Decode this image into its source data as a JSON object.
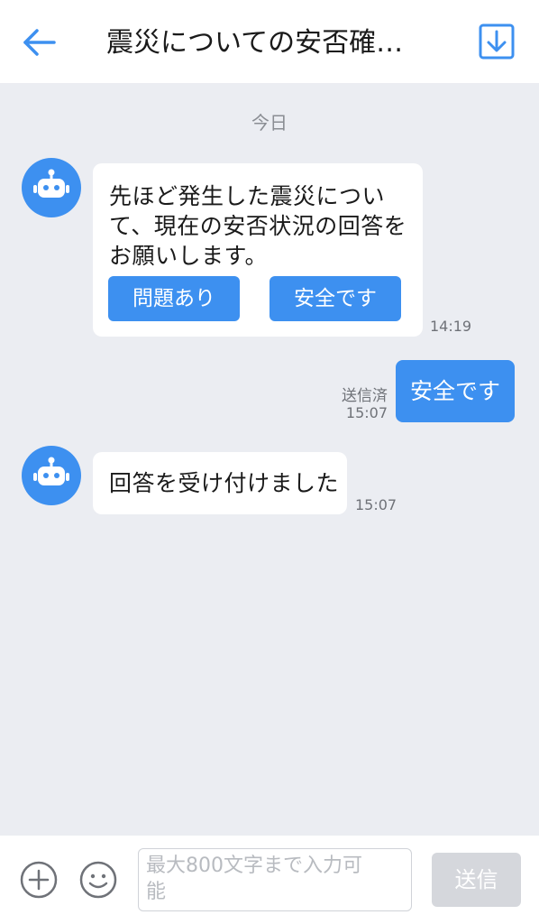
{
  "header": {
    "title": "震災についての安否確…",
    "back_icon": "arrow-left-icon",
    "download_icon": "download-icon",
    "accent_color": "#3d90f0"
  },
  "chat": {
    "date_label": "今日",
    "messages": [
      {
        "sender": "bot",
        "avatar_icon": "robot-icon",
        "text_lines": [
          "先ほど発生した震災につい",
          "て、現在の安否状況の回答を",
          "お願いします。"
        ],
        "buttons": [
          "問題あり",
          "安全です"
        ],
        "time": "14:19"
      },
      {
        "sender": "user",
        "text": "安全です",
        "status": "送信済",
        "time": "15:07"
      },
      {
        "sender": "bot",
        "avatar_icon": "robot-icon",
        "text": "回答を受け付けました",
        "time": "15:07"
      }
    ]
  },
  "input_bar": {
    "add_icon": "plus-circle-icon",
    "emoji_icon": "smiley-icon",
    "placeholder_line1": "最大800文字まで入力可",
    "placeholder_line2": "能",
    "send_label": "送信"
  }
}
